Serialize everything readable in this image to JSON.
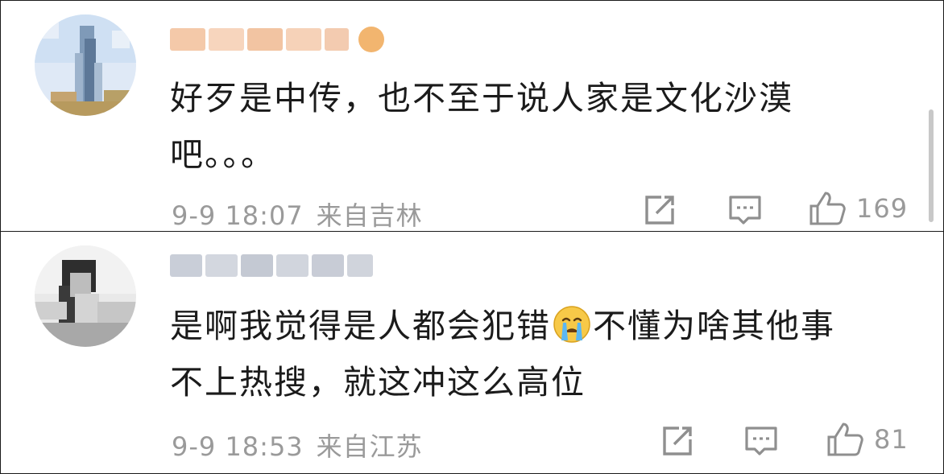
{
  "comments": [
    {
      "username": "",
      "text_lines": [
        "好歹是中传，也不至于说人家是文化沙漠",
        "吧。。。"
      ],
      "date": "9-9 18:07",
      "location": "来自吉林",
      "like_count": "169",
      "icons": {
        "share": "share-icon",
        "comment": "comment-icon",
        "like": "thumbs-up-icon"
      }
    },
    {
      "username": "",
      "text_line1_before": "是啊我觉得是人都会犯错",
      "text_line1_emoji": "crying-face-emoji",
      "text_line1_after": "不懂为啥其他事",
      "text_line2": "不上热搜，就这冲这么高位",
      "date": "9-9 18:53",
      "location": "来自江苏",
      "like_count": "81",
      "icons": {
        "share": "share-icon",
        "comment": "comment-icon",
        "like": "thumbs-up-icon"
      }
    }
  ],
  "colors": {
    "text": "#1b1b1b",
    "meta": "#9a9a9a",
    "icon": "#8f8f8f",
    "username_blur_1": "#f3c7a8",
    "username_blur_2": "#c9cdd6"
  }
}
